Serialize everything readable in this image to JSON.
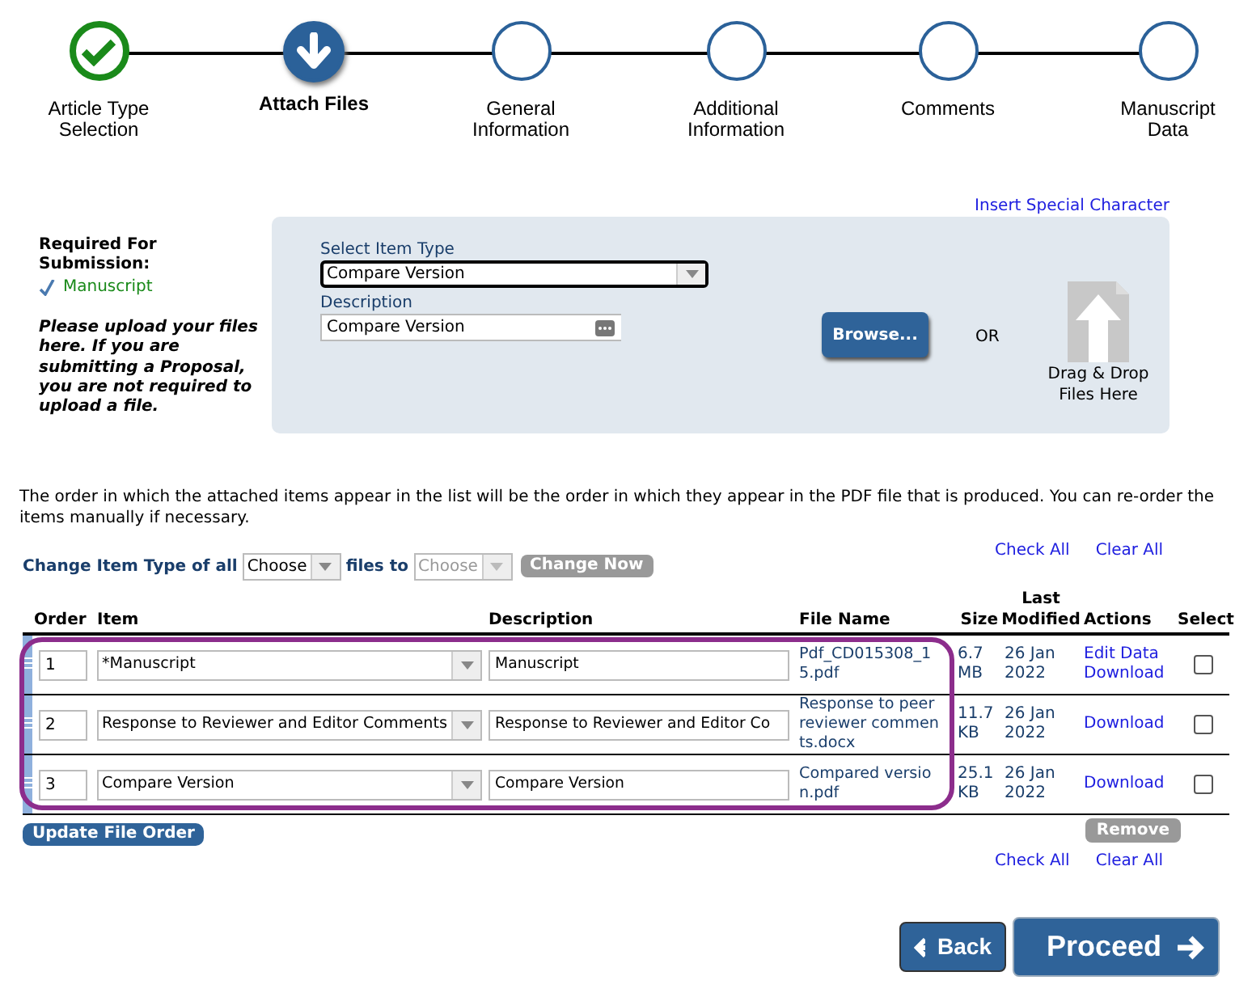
{
  "steps": [
    {
      "label": "Article Type Selection",
      "completed": true,
      "selected": false
    },
    {
      "label": "Attach Files",
      "completed": false,
      "selected": true
    },
    {
      "label": "General Information",
      "completed": false,
      "selected": false
    },
    {
      "label": "Additional Information",
      "completed": false,
      "selected": false
    },
    {
      "label": "Comments",
      "completed": false,
      "selected": false
    },
    {
      "label": "Manuscript Data",
      "completed": false,
      "selected": false
    }
  ],
  "special_character_link": "Insert Special Character",
  "requirements": {
    "heading": "Required For Submission:",
    "items": [
      {
        "label": "Manuscript",
        "checked": true
      }
    ],
    "note": "Please upload your files here. If you are submitting a Proposal, you are not required to upload a file."
  },
  "upload": {
    "item_type_label": "Select Item Type",
    "item_type_value": "Compare Version",
    "description_label": "Description",
    "description_value": "Compare Version",
    "browse_button": "Browse...",
    "or_text": "OR",
    "drop_zone": "Drag & Drop Files Here"
  },
  "order_note": "The order in which the attached items appear in the list will be the order in which they appear in the PDF file that is produced. You can re-order the items manually if necessary.",
  "change_type": {
    "label_before": "Change Item Type of all",
    "from_value": "Choose",
    "label_middle": "files to",
    "to_value": "Choose",
    "to_disabled": true,
    "button": "Change Now",
    "button_disabled": true
  },
  "top_links": [
    "Check All",
    "Clear All"
  ],
  "table": {
    "columns": [
      "Order",
      "Item",
      "Description",
      "File Name",
      "Size",
      "Last Modified",
      "Actions",
      "Select"
    ],
    "outlined": true,
    "rows": [
      {
        "order": "1",
        "item": "*Manuscript",
        "description": "Manuscript",
        "file_name": "Pdf_CD015308_15.pdf",
        "size": "6.7 MB",
        "modified": "26 Jan 2022",
        "actions": [
          "Edit Data",
          "Download"
        ],
        "selected": false
      },
      {
        "order": "2",
        "item": "Response to Reviewer and Editor Comments",
        "description": "Response to Reviewer and Editor Co",
        "file_name": "Response to peer reviewer comments.docx",
        "size": "11.7 KB",
        "modified": "26 Jan 2022",
        "actions": [
          "Download"
        ],
        "selected": false
      },
      {
        "order": "3",
        "item": "Compare Version",
        "description": "Compare Version",
        "file_name": "Compared version.pdf",
        "size": "25.1 KB",
        "modified": "26 Jan 2022",
        "actions": [
          "Download"
        ],
        "selected": false
      }
    ]
  },
  "update_button": "Update File Order",
  "remove_button": {
    "label": "Remove",
    "disabled": true
  },
  "bottom_links": [
    "Check All",
    "Clear All"
  ],
  "back_button": "Back",
  "proceed_button": "Proceed"
}
